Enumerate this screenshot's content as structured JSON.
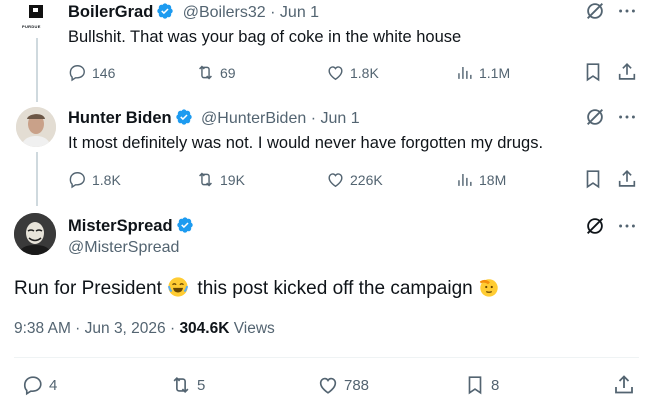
{
  "tweets": [
    {
      "name": "BoilerGrad",
      "handle": "@Boilers32",
      "date": "· Jun 1",
      "text": "Bullshit. That was your bag of coke in the white house",
      "replies": "146",
      "retweets": "69",
      "likes": "1.8K",
      "views": "1.1M",
      "avatar_text": "PURDUE"
    },
    {
      "name": "Hunter Biden",
      "handle": "@HunterBiden",
      "date": "· Jun 1",
      "text": "It most definitely was not. I would never have forgotten my drugs.",
      "replies": "1.8K",
      "retweets": "19K",
      "likes": "226K",
      "views": "18M"
    }
  ],
  "main": {
    "name": "MisterSpread",
    "handle": "@MisterSpread",
    "text_before": "Run for President",
    "text_after": "this post kicked off the campaign",
    "time": "9:38 AM · Jun 3, 2026 ·",
    "views_count": "304.6K",
    "views_label": "Views",
    "replies": "4",
    "retweets": "5",
    "likes": "788",
    "bookmarks": "8"
  },
  "colors": {
    "verified": "#1d9bf0",
    "muted": "#536471",
    "text": "#0f1419"
  },
  "icons": [
    "reply-icon",
    "retweet-icon",
    "like-icon",
    "views-icon",
    "bookmark-icon",
    "share-icon",
    "grok-icon",
    "more-icon",
    "verified-icon",
    "laughing-emoji",
    "saluting-emoji"
  ]
}
